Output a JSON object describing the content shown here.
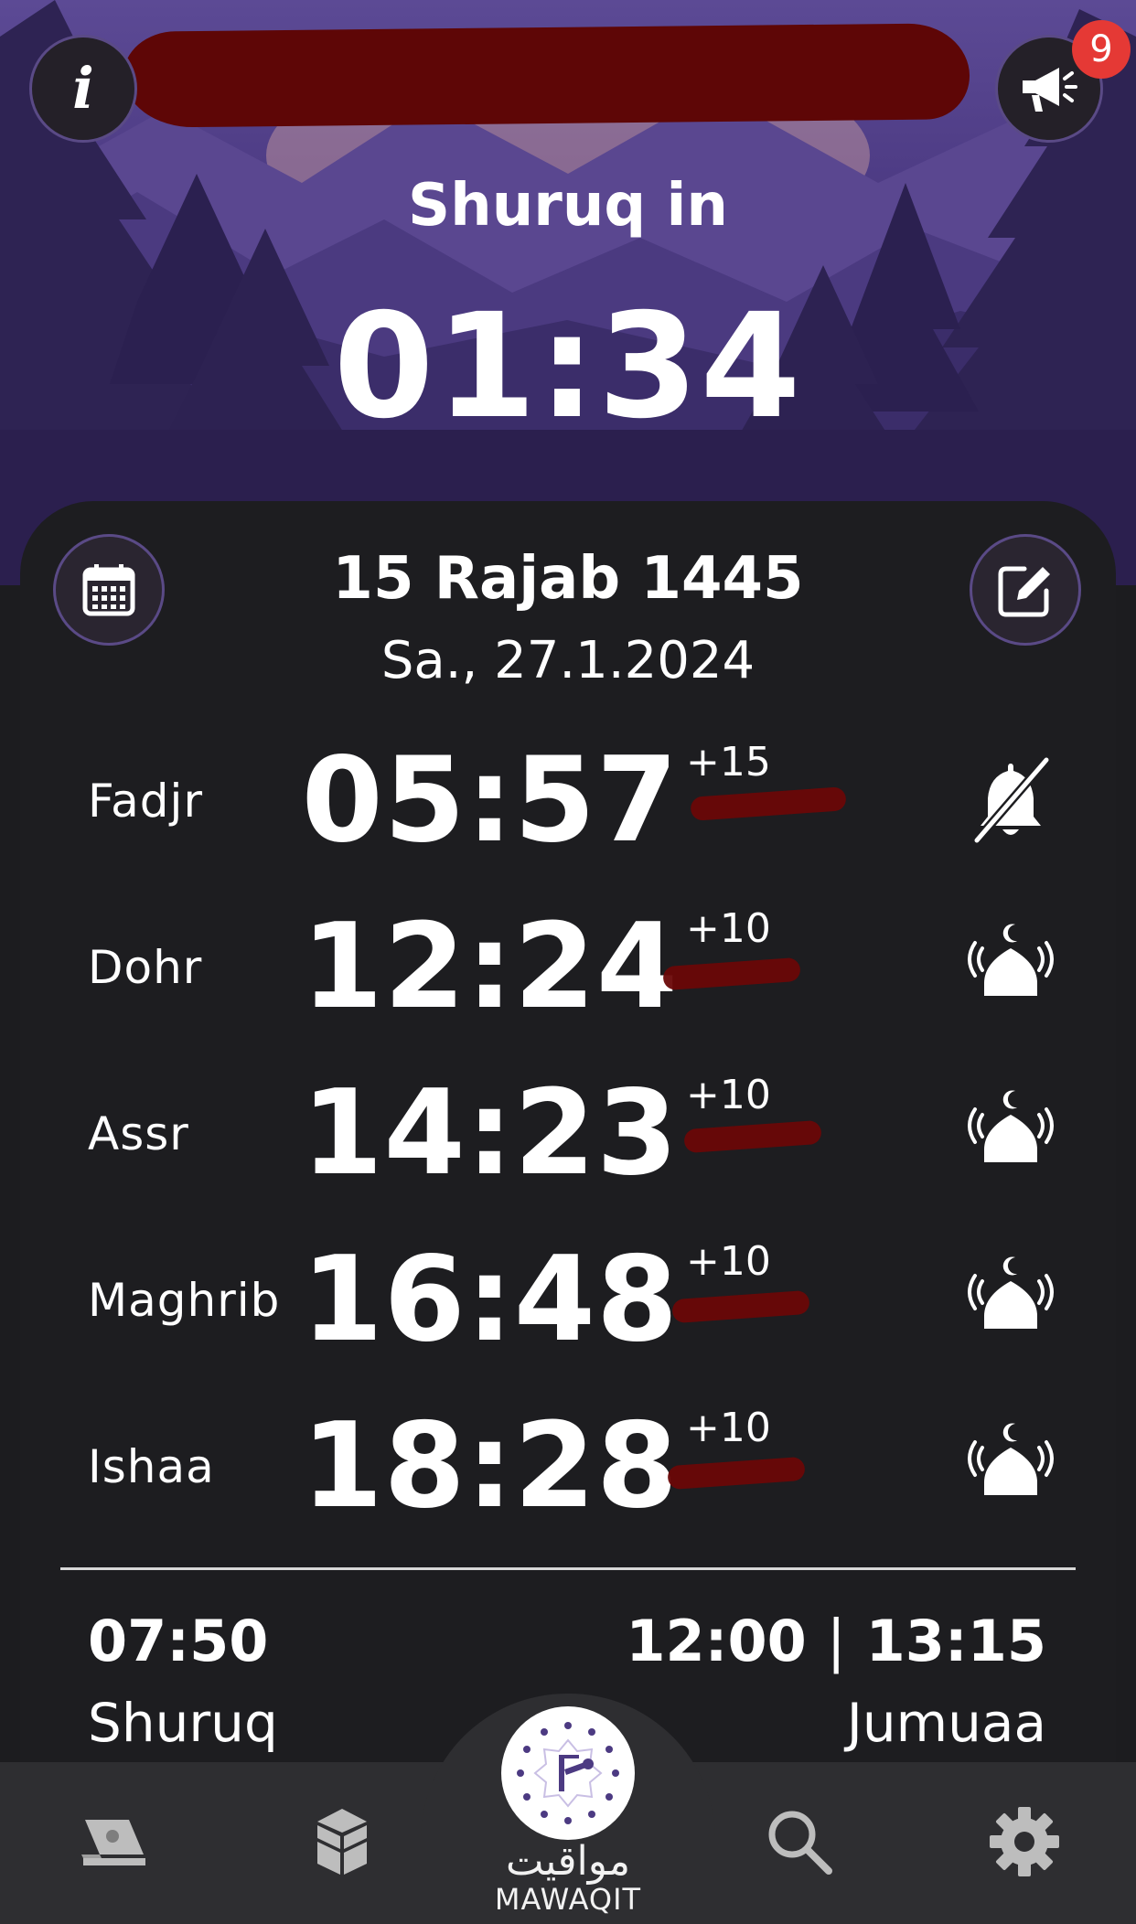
{
  "header": {
    "countdown_label": "Shuruq in",
    "countdown_time": "01:34",
    "notification_count": "9",
    "info_glyph": "i",
    "icons": {
      "info": "info-icon",
      "announce": "megaphone-icon"
    }
  },
  "date": {
    "hijri": "15 Rajab 1445",
    "gregorian": "Sa., 27.1.2024",
    "icons": {
      "calendar": "calendar-icon",
      "edit": "edit-icon"
    }
  },
  "prayers": [
    {
      "name": "Fadjr",
      "time": "05:57",
      "offset": "+15",
      "alert": "bell-muted-icon"
    },
    {
      "name": "Dohr",
      "time": "12:24",
      "offset": "+10",
      "alert": "mosque-adhan-icon"
    },
    {
      "name": "Assr",
      "time": "14:23",
      "offset": "+10",
      "alert": "mosque-adhan-icon"
    },
    {
      "name": "Maghrib",
      "time": "16:48",
      "offset": "+10",
      "alert": "mosque-adhan-icon"
    },
    {
      "name": "Ishaa",
      "time": "18:28",
      "offset": "+10",
      "alert": "mosque-adhan-icon"
    }
  ],
  "footer": {
    "shuruq_time": "07:50",
    "shuruq_label": "Shuruq",
    "jumuaa_time_1": "12:00",
    "jumuaa_sep": "|",
    "jumuaa_time_2": "13:15",
    "jumuaa_label": "Jumuaa"
  },
  "nav": {
    "items": [
      {
        "icon": "quran-icon"
      },
      {
        "icon": "kaaba-icon"
      },
      {
        "icon": "mawaqit-logo-icon"
      },
      {
        "icon": "search-icon"
      },
      {
        "icon": "settings-icon"
      }
    ],
    "logo_arabic": "مواقيت",
    "logo_latin": "MAWAQIT"
  },
  "colors": {
    "accent_purple": "#5a4a86",
    "badge_red": "#e53935",
    "card_bg": "#1d1d20",
    "nav_bg": "#2e2e31"
  }
}
